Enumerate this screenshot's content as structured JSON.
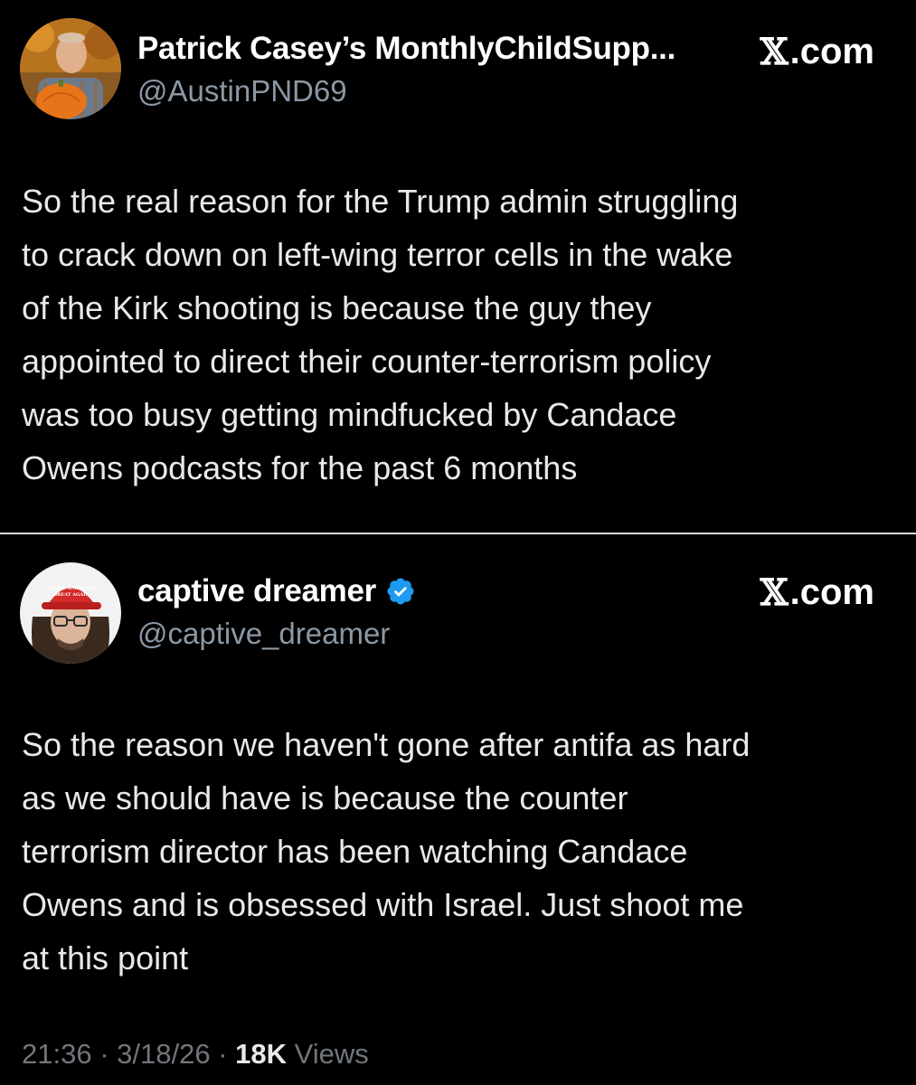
{
  "tweets": [
    {
      "display_name": "Patrick Casey’s MonthlyChildSupp...",
      "handle": "@AustinPND69",
      "source": ".com",
      "source_icon": "x-logo-icon",
      "text": "So the real reason for the Trump admin struggling\nto crack down on left-wing terror cells in the wake\nof the Kirk shooting is because the guy they\nappointed to direct their counter-terrorism policy\nwas too busy getting mindfucked by Candace\nOwens podcasts for the past 6 months"
    },
    {
      "display_name": "captive dreamer",
      "verified": true,
      "handle": "@captive_dreamer",
      "source": ".com",
      "source_icon": "x-logo-icon",
      "avatar_hat_text": [
        "MAKE AMERICA",
        "GREAT AGAIN"
      ],
      "text": "So the reason we haven't gone after antifa as hard\nas we should have is because the counter\nterrorism director has been watching Candace\nOwens and is obsessed with Israel. Just shoot me\nat this point",
      "meta": {
        "time": "21:36",
        "separator": "·",
        "date": "3/18/26",
        "views_count": "18K",
        "views_label": "Views"
      }
    }
  ],
  "colors": {
    "background": "#000000",
    "text_primary": "#e7e9ea",
    "text_secondary": "#8b98a5",
    "verified_badge": "#1d9bf0",
    "divider": "#d9d9d9"
  }
}
